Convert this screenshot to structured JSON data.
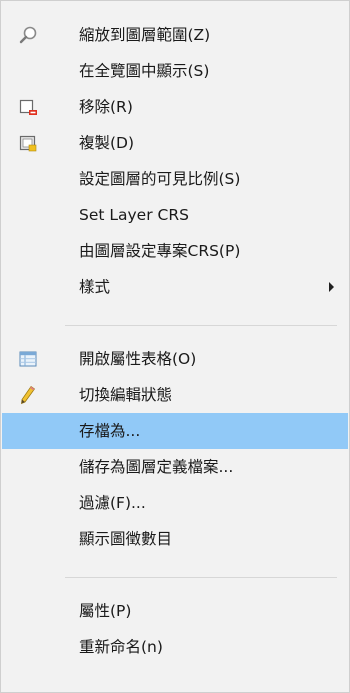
{
  "menu": {
    "items": [
      {
        "label": "縮放到圖層範圍(Z)",
        "icon": "zoom-icon"
      },
      {
        "label": "在全覽圖中顯示(S)",
        "icon": ""
      },
      {
        "label": "移除(R)",
        "icon": "remove-layer-icon"
      },
      {
        "label": "複製(D)",
        "icon": "duplicate-layer-icon"
      },
      {
        "label": "設定圖層的可見比例(S)",
        "icon": ""
      },
      {
        "label": "Set Layer CRS",
        "icon": ""
      },
      {
        "label": "由圖層設定專案CRS(P)",
        "icon": ""
      },
      {
        "label": "樣式",
        "icon": "",
        "submenu": true
      },
      {
        "label": "開啟屬性表格(O)",
        "icon": "attribute-table-icon"
      },
      {
        "label": "切換編輯狀態",
        "icon": "pencil-icon"
      },
      {
        "label": "存檔為...",
        "icon": "",
        "highlighted": true
      },
      {
        "label": "儲存為圖層定義檔案...",
        "icon": ""
      },
      {
        "label": "過濾(F)...",
        "icon": ""
      },
      {
        "label": "顯示圖徵數目",
        "icon": ""
      },
      {
        "label": "屬性(P)",
        "icon": ""
      },
      {
        "label": "重新命名(n)",
        "icon": ""
      }
    ]
  },
  "colors": {
    "background": "#f2f2f2",
    "highlight": "#91c9f7",
    "text": "#1a1a1a",
    "separator": "#d7d7d7",
    "icon_red": "#e0301e",
    "icon_yellow": "#f0c020"
  }
}
